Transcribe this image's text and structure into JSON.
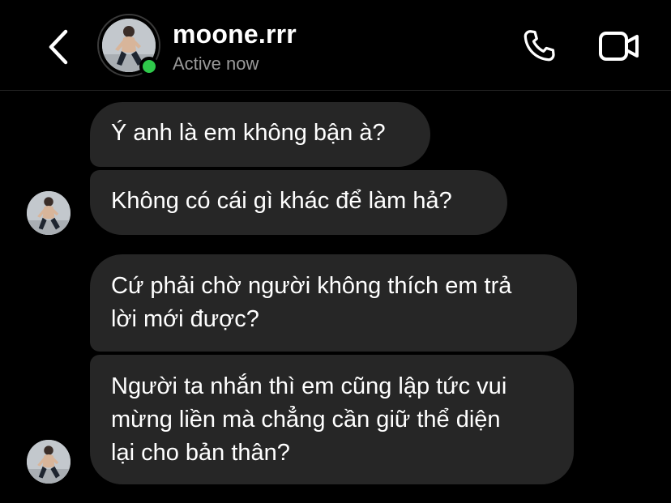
{
  "header": {
    "username": "moone.rrr",
    "status": "Active now"
  },
  "messages": [
    {
      "text": "Ý anh là em không bận à?"
    },
    {
      "text": "Không có cái gì khác để làm hả?"
    },
    {
      "text": "Cứ phải chờ người không thích em trả\nlời mới được?"
    },
    {
      "text": "Người ta nhắn thì em cũng lập tức vui\nmừng liền mà chẳng cần giữ thể diện\nlại cho bản thân?"
    }
  ],
  "icons": {
    "back": "chevron-left-icon",
    "call": "phone-icon",
    "video": "video-camera-icon",
    "online": "online-status-dot"
  },
  "colors": {
    "background": "#000000",
    "bubble": "#262626",
    "online": "#2fc94b",
    "secondary_text": "#9a9a9a"
  }
}
